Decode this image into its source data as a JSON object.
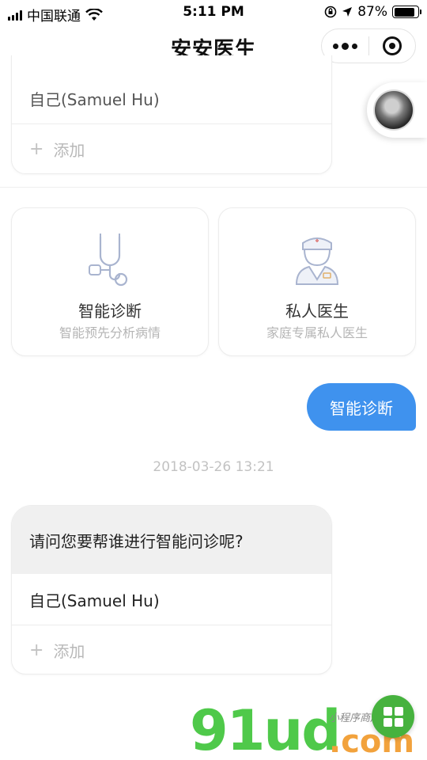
{
  "status_bar": {
    "carrier": "中国联通",
    "time": "5:11 PM",
    "battery_percent": "87%",
    "battery_level": 0.87,
    "icons": [
      "signal-icon",
      "wifi-icon",
      "rotation-lock-icon",
      "location-arrow-icon",
      "battery-icon"
    ]
  },
  "nav": {
    "title": "安安医生",
    "more_icon": "more-dots-icon",
    "close_icon": "target-circle-icon"
  },
  "top_options": {
    "self_label": "自己(Samuel Hu)",
    "add_label": "添加",
    "add_icon": "plus-icon"
  },
  "avatar_icon": "user-avatar-icon",
  "services": [
    {
      "title": "智能诊断",
      "subtitle": "智能预先分析病情",
      "icon": "stethoscope-icon"
    },
    {
      "title": "私人医生",
      "subtitle": "家庭专属私人医生",
      "icon": "doctor-icon"
    }
  ],
  "chat": {
    "user_message": "智能诊断",
    "timestamp": "2018-03-26 13:21",
    "bot_question": "请问您要帮谁进行智能问诊呢?",
    "options": [
      "自己(Samuel Hu)"
    ],
    "add_label": "添加"
  },
  "watermark": {
    "text": "91ud",
    "suffix": ".com",
    "signature": "小程序商店"
  },
  "colors": {
    "accent": "#3f92ee",
    "watermark_green": "#4fc94a",
    "watermark_orange": "#f2a23c"
  }
}
